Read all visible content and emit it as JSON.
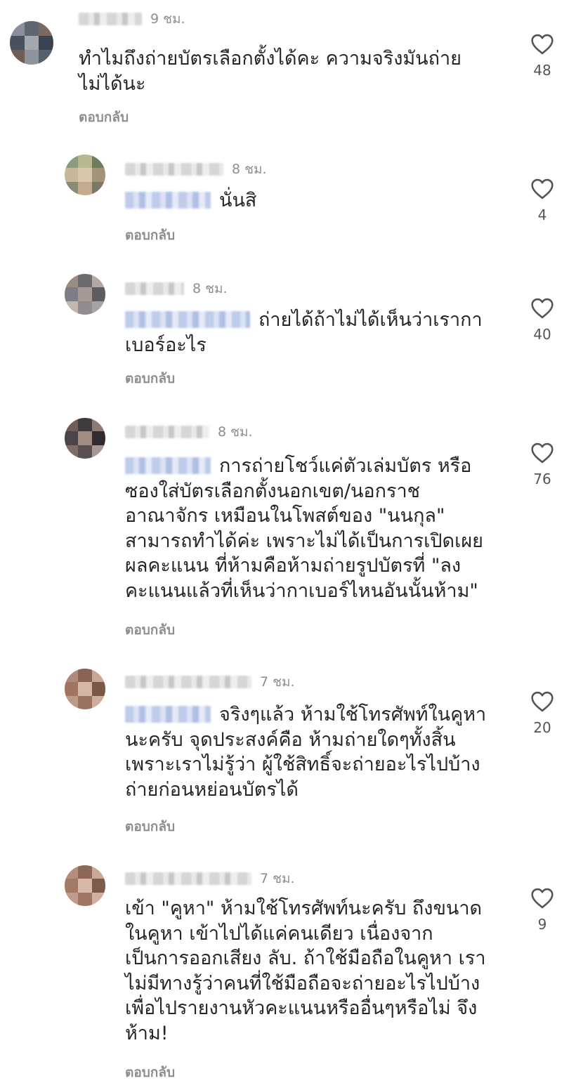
{
  "comments": [
    {
      "username": "",
      "time": "9 ชม.",
      "text": "ทำไมถึงถ่ายบัตรเลือกตั้งได้คะ ความจริงมันถ่าย\nไม่ได้นะ",
      "reply_label": "ตอบกลับ",
      "likes": "48",
      "avatar_colors": [
        "#8b8f9a",
        "#5e6470",
        "#7a6a60",
        "#49515e",
        "#a3a7ae",
        "#3c4350",
        "#6f5e55",
        "#8d949d",
        "#55606f"
      ]
    },
    {
      "username": "",
      "time": "8 ชม.",
      "text": "นั่นสิ",
      "reply_label": "ตอบกลับ",
      "likes": "4",
      "avatar_colors": [
        "#8e9a7c",
        "#b6b98f",
        "#6f7d5e",
        "#c9b79b",
        "#d8c7a9",
        "#a39379",
        "#8b8a74",
        "#c3ab8d",
        "#7a7966"
      ]
    },
    {
      "username": "",
      "time": "8 ชม.",
      "text": "ถ่ายได้ถ้าไม่ได้เห็นว่าเรากา\nเบอร์อะไร",
      "reply_label": "ตอบกลับ",
      "likes": "40",
      "avatar_colors": [
        "#9a8b86",
        "#6d6b70",
        "#b7a7a0",
        "#7e7c86",
        "#a69a96",
        "#5e5c63",
        "#c1b6b0",
        "#8f8c92",
        "#aaa2a0"
      ]
    },
    {
      "username": "",
      "time": "8 ชม.",
      "text": "การถ่ายโชว์แค่ตัวเล่มบัตร หรือ\nซองใส่บัตรเลือกตั้งนอกเขต/นอกราช\nอาณาจักร เหมือนในโพสต์ของ \"นนกุล\"\nสามารถทำได้ค่ะ เพราะไม่ได้เป็นการเปิดเผย\nผลคะแนน ที่ห้ามคือห้ามถ่ายรูปบัตรที่ \"ลง\nคะแนนแล้วที่เห็นว่ากาเบอร์ไหนอันนั้นห้าม\"",
      "reply_label": "ตอบกลับ",
      "likes": "76",
      "avatar_colors": [
        "#6e5e58",
        "#3f3a3c",
        "#8c7b72",
        "#4d4447",
        "#9e8c82",
        "#2f2b2e",
        "#7d6d66",
        "#5a4f51",
        "#a89890"
      ]
    },
    {
      "username": "",
      "time": "7 ชม.",
      "text": "จริงๆแล้ว ห้ามใช้โทรศัพท์ในคูหา\nนะครับ จุดประสงค์คือ ห้ามถ่ายใดๆทั้งสิ้น\nเพราะเราไม่รู้ว่า ผู้ใช้สิทธิ์จะถ่ายอะไรไปบ้าง\nถ่ายก่อนหย่อนบัตรได้",
      "reply_label": "ตอบกลับ",
      "likes": "20",
      "avatar_colors": [
        "#b08a78",
        "#8a6454",
        "#c9a796",
        "#a07560",
        "#d4b6a6",
        "#7b5747",
        "#bf9a88",
        "#9c7260",
        "#cfae9e"
      ]
    },
    {
      "username": "",
      "time": "7 ชม.",
      "text": "เข้า \"คูหา\" ห้ามใช้โทรศัพท์นะครับ ถึงขนาด\nในคูหา เข้าไปได้แค่คนเดียว เนื่องจาก\nเป็นการออกเสียง ลับ. ถ้าใช้มือถือในคูหา เรา\nไม่มีทางรู้ว่าคนที่ใช้มือถือจะถ่ายอะไรไปบ้าง\nเพื่อไปรายงานหัวคะแนนหรืออื่นๆหรือไม่ จึง\nห้าม!",
      "reply_label": "ตอบกลับ",
      "likes": "9",
      "avatar_colors": [
        "#b48e7c",
        "#8d6858",
        "#cba998",
        "#a47a66",
        "#d6b8a8",
        "#7e5a4a",
        "#c19c8a",
        "#9f7563",
        "#d1b0a0"
      ]
    }
  ],
  "colors": {
    "text": "#262626",
    "muted": "#8e8e8e",
    "mention_blur": "#b8c6e8",
    "background": "#ffffff"
  },
  "icons": {
    "like": "heart-outline-icon"
  }
}
